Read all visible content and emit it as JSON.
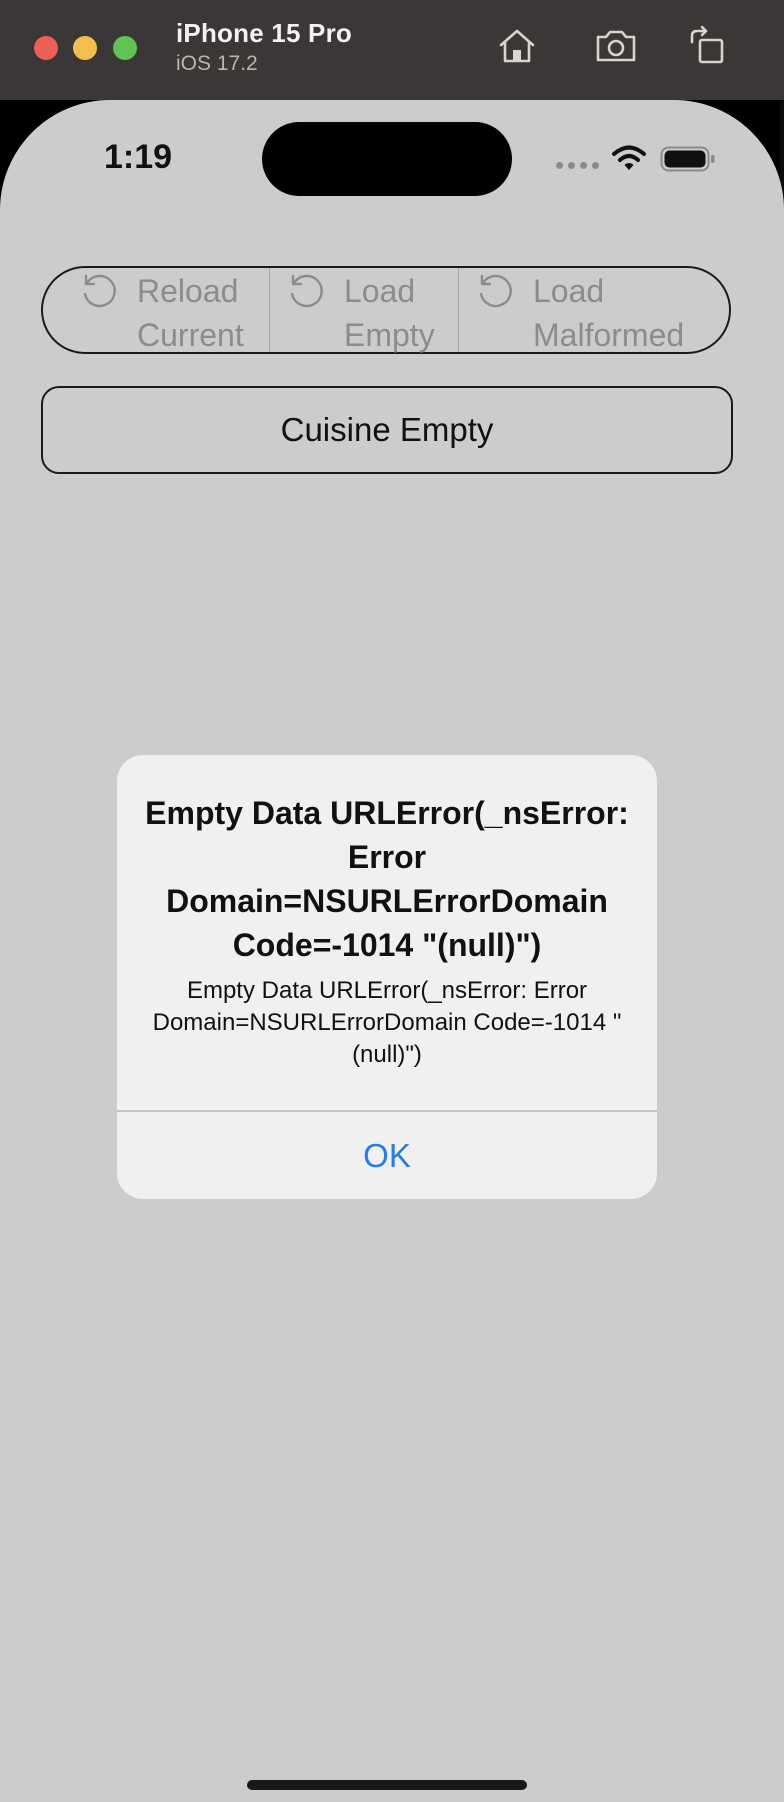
{
  "simulator": {
    "device_name": "iPhone 15 Pro",
    "os_version": "iOS 17.2",
    "toolbar_icons": [
      "home-icon",
      "screenshot-icon",
      "rotate-icon"
    ]
  },
  "status_bar": {
    "time": "1:19",
    "icons": [
      "signal-dots-icon",
      "wifi-icon",
      "battery-icon"
    ]
  },
  "reload_control": {
    "segments": [
      {
        "icon": "refresh-icon",
        "label": "Reload\nCurrent"
      },
      {
        "icon": "refresh-icon",
        "label": "Load\nEmpty"
      },
      {
        "icon": "refresh-icon",
        "label": "Load\nMalformed"
      }
    ]
  },
  "cuisine_picker": {
    "label": "Cuisine Empty"
  },
  "alert": {
    "title": "Empty Data URLError(_nsError: Error Domain=NSURLErrorDomain Code=-1014 \"(null)\")",
    "message": "Empty Data URLError(_nsError: Error Domain=NSURLErrorDomain Code=-1014 \"(null)\")",
    "ok_label": "OK"
  },
  "colors": {
    "titlebar": "#3b3736",
    "screen_background": "#cccccc",
    "alert_background": "#f0f0f0",
    "accent": "#2f79e3",
    "disabled_text": "#8c8c8c"
  }
}
